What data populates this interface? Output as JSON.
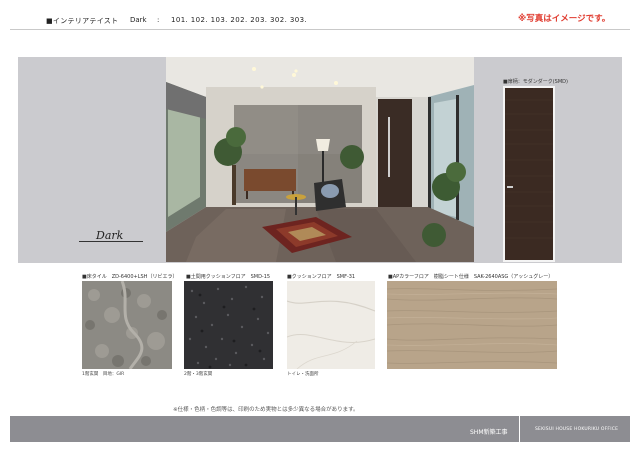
{
  "header": {
    "title": "■インテリアテイスト",
    "taste": "Dark",
    "colon": ":",
    "units": "101. 102. 103. 202. 203. 302. 303.",
    "note": "※写真はイメージです。"
  },
  "showcase": {
    "label": "Dark",
    "door_caption": "■扉柄：モダンダーク(SMD)"
  },
  "swatches": [
    {
      "caption": "■床タイル　ZD-6400+LSH（リビエラ）",
      "sub": "1階玄関　目地：GIR"
    },
    {
      "caption": "■土間用クッションフロア　SMD-15",
      "sub": "2階・3階玄関"
    },
    {
      "caption": "■クッションフロア　SMF-31",
      "sub": "トイレ・洗面所"
    },
    {
      "caption": "■APカラーフロア　樹脂シート仕様　SAK-2640ASG（アッシュグレー）",
      "sub": ""
    }
  ],
  "footnote": "※仕様・色柄・色調等は、印刷のため実物とは多少異なる場合があります。",
  "footer": {
    "left": "SHM新築工事",
    "right": "SEKISUI HOUSE HOKURIKU OFFICE"
  },
  "colors": {
    "note_red": "#e03a2e",
    "panel_gray": "#cbcbcf",
    "footer_gray": "#8d8d92",
    "door_brown": "#3b2a22",
    "floor_oak": "#b8a48a"
  }
}
